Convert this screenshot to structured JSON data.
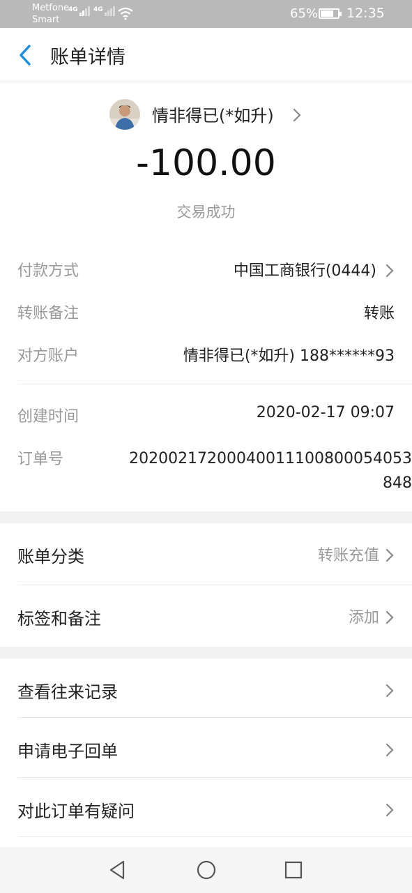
{
  "status_bar": {
    "carrier_line1": "Metfone",
    "carrier_line2": "Smart",
    "net1": "4G",
    "net2": "4G",
    "battery": "65%",
    "time": "12:35"
  },
  "navbar": {
    "back_icon": "chevron-left-icon",
    "title": "账单详情"
  },
  "header": {
    "payee": "情非得已(*如升)",
    "amount": "-100.00",
    "status": "交易成功"
  },
  "details": {
    "payment_method": {
      "label": "付款方式",
      "value": "中国工商银行(0444)"
    },
    "note": {
      "label": "转账备注",
      "value": "转账"
    },
    "counterparty": {
      "label": "对方账户",
      "value": "情非得已(*如升) 188******93"
    },
    "created": {
      "label": "创建时间",
      "value": "2020-02-17 09:07"
    },
    "order_no": {
      "label": "订单号",
      "value": "2020021720004001110080005405384​8"
    }
  },
  "category_section": {
    "category": {
      "label": "账单分类",
      "value": "转账充值"
    },
    "tags": {
      "label": "标签和备注",
      "value": "添加"
    }
  },
  "actions": [
    {
      "label": "查看往来记录"
    },
    {
      "label": "申请电子回单"
    },
    {
      "label": "对此订单有疑问"
    }
  ],
  "colors": {
    "accent": "#1a8fe0",
    "muted": "#999999",
    "background": "#f2f2f2"
  }
}
